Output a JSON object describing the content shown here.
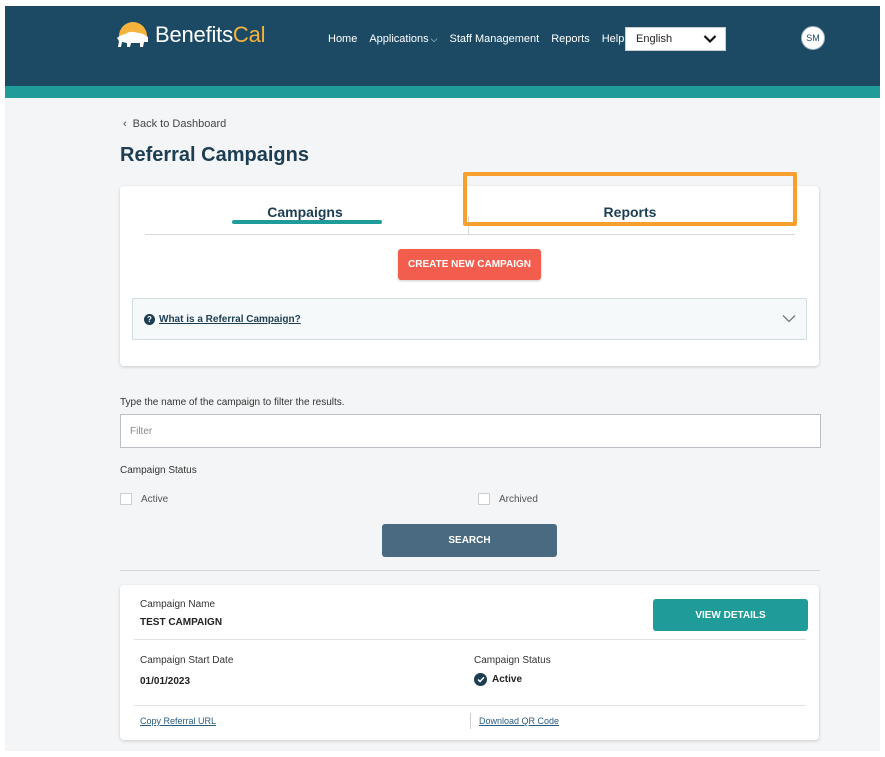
{
  "brand": {
    "name_primary": "Benefits",
    "name_accent": "Cal"
  },
  "nav": {
    "items": [
      "Home",
      "Applications",
      "Staff Management",
      "Reports",
      "Help"
    ],
    "language": "English",
    "user_initials": "SM"
  },
  "back_link": "Back to Dashboard",
  "page_title": "Referral Campaigns",
  "tabs": {
    "campaigns": "Campaigns",
    "reports": "Reports"
  },
  "create_button": "CREATE NEW CAMPAIGN",
  "accordion": {
    "label": "What is a Referral Campaign?",
    "help_glyph": "?"
  },
  "filter": {
    "hint": "Type the name of the campaign to filter the results.",
    "placeholder": "Filter"
  },
  "status_filter": {
    "label": "Campaign Status",
    "options": [
      "Active",
      "Archived"
    ]
  },
  "search_button": "SEARCH",
  "campaign": {
    "name_label": "Campaign Name",
    "name": "TEST CAMPAIGN",
    "view_button": "VIEW DETAILS",
    "start_date_label": "Campaign Start Date",
    "start_date": "01/01/2023",
    "status_label": "Campaign Status",
    "status": "Active",
    "copy_link": "Copy Referral URL",
    "download_link": "Download QR Code"
  },
  "colors": {
    "header": "#1c4a64",
    "teal": "#1f9b9a",
    "create_button": "#f35d4e",
    "highlight": "#f7a030",
    "search_button": "#4a6a82"
  }
}
